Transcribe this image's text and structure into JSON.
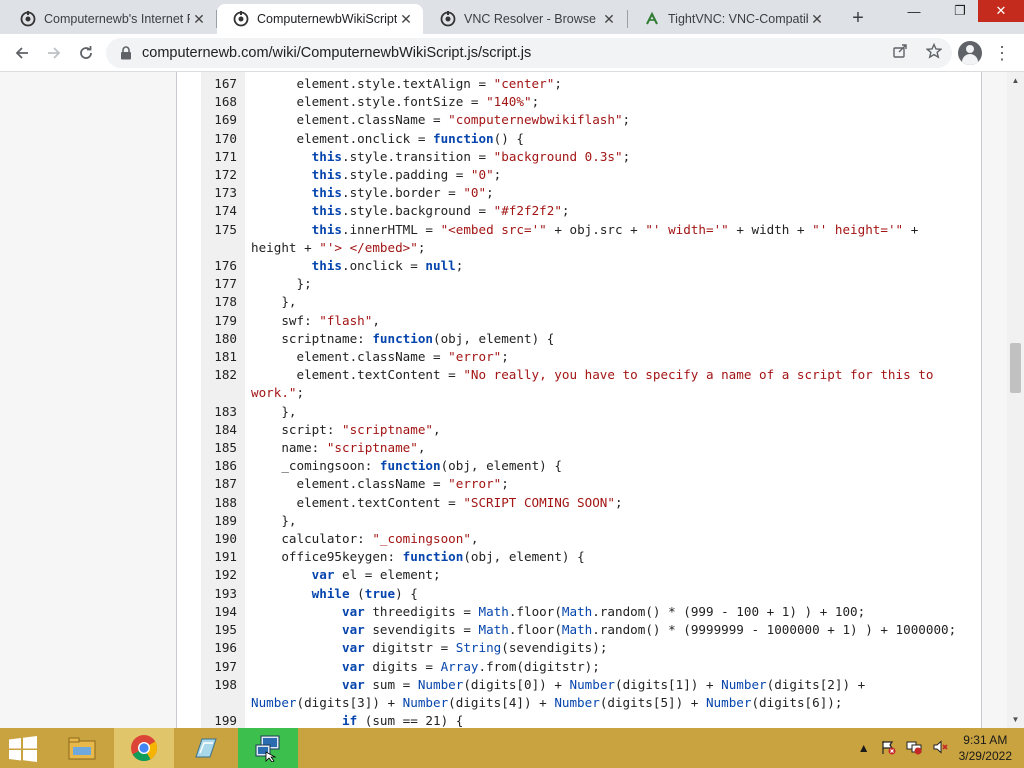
{
  "tabs": [
    {
      "title": "Computernewb's Internet Pinball",
      "favicon": "vm-icon",
      "active": false
    },
    {
      "title": "ComputernewbWikiScript.js",
      "favicon": "vm-icon",
      "active": true
    },
    {
      "title": "VNC Resolver - Browse",
      "favicon": "vm-icon",
      "active": false
    },
    {
      "title": "TightVNC: VNC-Compatible",
      "favicon": "tightvnc-icon",
      "active": false
    }
  ],
  "toolbar": {
    "url": "computernewb.com/wiki/ComputernewbWikiScript.js/script.js"
  },
  "code_lines": [
    {
      "n": "167",
      "html": "      element.style.textAlign = <span class=\"str\">\"center\"</span>;"
    },
    {
      "n": "168",
      "html": "      element.style.fontSize = <span class=\"str\">\"140%\"</span>;"
    },
    {
      "n": "169",
      "html": "      element.className = <span class=\"str\">\"computernewbwikiflash\"</span>;"
    },
    {
      "n": "170",
      "html": "      element.onclick = <span class=\"kw\">function</span>() {"
    },
    {
      "n": "171",
      "html": "        <span class=\"kw\">this</span>.style.transition = <span class=\"str\">\"background 0.3s\"</span>;"
    },
    {
      "n": "172",
      "html": "        <span class=\"kw\">this</span>.style.padding = <span class=\"str\">\"0\"</span>;"
    },
    {
      "n": "173",
      "html": "        <span class=\"kw\">this</span>.style.border = <span class=\"str\">\"0\"</span>;"
    },
    {
      "n": "174",
      "html": "        <span class=\"kw\">this</span>.style.background = <span class=\"str\">\"#f2f2f2\"</span>;"
    },
    {
      "n": "175",
      "html": "        <span class=\"kw\">this</span>.innerHTML = <span class=\"str\">\"&lt;embed src='\"</span> + obj.src + <span class=\"str\">\"' width='\"</span> + width + <span class=\"str\">\"' height='\"</span> +",
      "cont": "height + <span class=\"str\">\"'&gt; &lt;/embed&gt;\"</span>;"
    },
    {
      "n": "176",
      "html": "        <span class=\"kw\">this</span>.onclick = <span class=\"kw\">null</span>;"
    },
    {
      "n": "177",
      "html": "      };"
    },
    {
      "n": "178",
      "html": "    },"
    },
    {
      "n": "179",
      "html": "    swf: <span class=\"str\">\"flash\"</span>,"
    },
    {
      "n": "180",
      "html": "    scriptname: <span class=\"kw\">function</span>(obj, element) {"
    },
    {
      "n": "181",
      "html": "      element.className = <span class=\"str\">\"error\"</span>;"
    },
    {
      "n": "182",
      "html": "      element.textContent = <span class=\"str\">\"No really, you have to specify a name of a script for this to</span>",
      "cont": "<span class=\"str\">work.\"</span>;"
    },
    {
      "n": "183",
      "html": "    },"
    },
    {
      "n": "184",
      "html": "    script: <span class=\"str\">\"scriptname\"</span>,"
    },
    {
      "n": "185",
      "html": "    name: <span class=\"str\">\"scriptname\"</span>,"
    },
    {
      "n": "186",
      "html": "    _comingsoon: <span class=\"kw\">function</span>(obj, element) {"
    },
    {
      "n": "187",
      "html": "      element.className = <span class=\"str\">\"error\"</span>;"
    },
    {
      "n": "188",
      "html": "      element.textContent = <span class=\"str\">\"SCRIPT COMING SOON\"</span>;"
    },
    {
      "n": "189",
      "html": "    },"
    },
    {
      "n": "190",
      "html": "    calculator: <span class=\"str\">\"_comingsoon\"</span>,"
    },
    {
      "n": "191",
      "html": "    office95keygen: <span class=\"kw\">function</span>(obj, element) {"
    },
    {
      "n": "192",
      "html": "        <span class=\"kw\">var</span> el = element;"
    },
    {
      "n": "193",
      "html": "        <span class=\"kw\">while</span> (<span class=\"kw\">true</span>) {"
    },
    {
      "n": "194",
      "html": "            <span class=\"kw\">var</span> threedigits = <span class=\"glob\">Math</span>.floor(<span class=\"glob\">Math</span>.random() * (999 - 100 + 1) ) + 100;"
    },
    {
      "n": "195",
      "html": "            <span class=\"kw\">var</span> sevendigits = <span class=\"glob\">Math</span>.floor(<span class=\"glob\">Math</span>.random() * (9999999 - 1000000 + 1) ) + 1000000;"
    },
    {
      "n": "196",
      "html": "            <span class=\"kw\">var</span> digitstr = <span class=\"glob\">String</span>(sevendigits);"
    },
    {
      "n": "197",
      "html": "            <span class=\"kw\">var</span> digits = <span class=\"glob\">Array</span>.from(digitstr);"
    },
    {
      "n": "198",
      "html": "            <span class=\"kw\">var</span> sum = <span class=\"glob\">Number</span>(digits[0]) + <span class=\"glob\">Number</span>(digits[1]) + <span class=\"glob\">Number</span>(digits[2]) +",
      "cont": "<span class=\"glob\">Number</span>(digits[3]) + <span class=\"glob\">Number</span>(digits[4]) + <span class=\"glob\">Number</span>(digits[5]) + <span class=\"glob\">Number</span>(digits[6]);"
    },
    {
      "n": "199",
      "html": "            <span class=\"kw\">if</span> (sum == 21) {"
    }
  ],
  "clock": {
    "time": "9:31 AM",
    "date": "3/29/2022"
  }
}
